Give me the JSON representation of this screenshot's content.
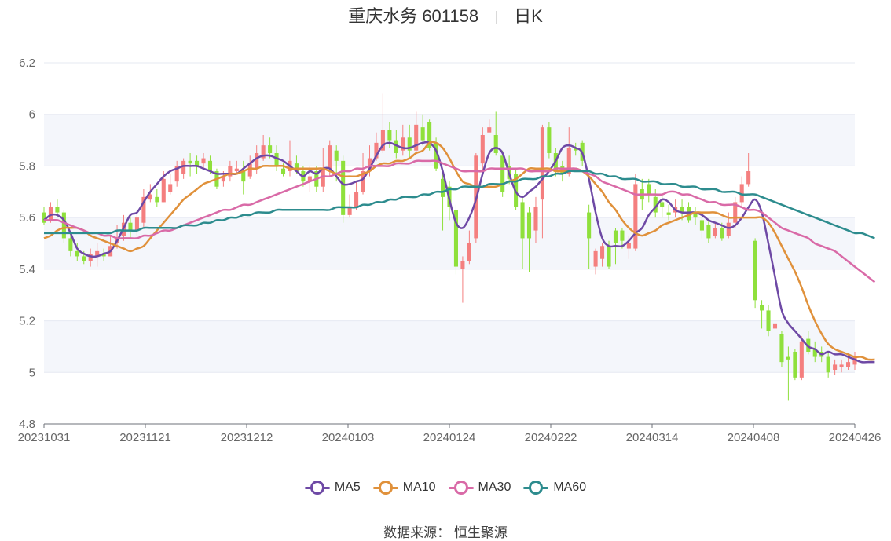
{
  "header": {
    "title": "重庆水务 601158",
    "period": "日K"
  },
  "source": {
    "label": "数据来源：",
    "value": "恒生聚源"
  },
  "colors": {
    "up": "#f47f7f",
    "down": "#8fe03c",
    "band": "#f4f6fb",
    "grid": "#e6e9f2",
    "MA5": "#6e49a5",
    "MA10": "#e0913b",
    "MA30": "#d96aa7",
    "MA60": "#2d8c8e"
  },
  "chart_data": {
    "type": "candlestick",
    "y_axis": {
      "min": 4.8,
      "max": 6.2,
      "ticks": [
        "6.2",
        "6",
        "5.8",
        "5.6",
        "5.4",
        "5.2",
        "5",
        "4.8"
      ]
    },
    "x_ticks": [
      "20231031",
      "20231121",
      "20231212",
      "20240103",
      "20240124",
      "20240222",
      "20240314",
      "20240408",
      "20240426"
    ],
    "legend": [
      "MA5",
      "MA10",
      "MA30",
      "MA60"
    ],
    "candles": [
      [
        5.62,
        5.58,
        5.64,
        5.57
      ],
      [
        5.59,
        5.64,
        5.66,
        5.58
      ],
      [
        5.64,
        5.62,
        5.67,
        5.6
      ],
      [
        5.62,
        5.52,
        5.63,
        5.5
      ],
      [
        5.52,
        5.47,
        5.54,
        5.45
      ],
      [
        5.47,
        5.45,
        5.5,
        5.43
      ],
      [
        5.45,
        5.43,
        5.47,
        5.42
      ],
      [
        5.43,
        5.46,
        5.48,
        5.41
      ],
      [
        5.45,
        5.47,
        5.5,
        5.41
      ],
      [
        5.46,
        5.45,
        5.48,
        5.43
      ],
      [
        5.45,
        5.49,
        5.53,
        5.45
      ],
      [
        5.5,
        5.52,
        5.57,
        5.48
      ],
      [
        5.53,
        5.58,
        5.61,
        5.51
      ],
      [
        5.58,
        5.55,
        5.6,
        5.52
      ],
      [
        5.55,
        5.6,
        5.63,
        5.53
      ],
      [
        5.58,
        5.68,
        5.71,
        5.56
      ],
      [
        5.67,
        5.69,
        5.73,
        5.66
      ],
      [
        5.68,
        5.66,
        5.71,
        5.64
      ],
      [
        5.66,
        5.75,
        5.78,
        5.66
      ],
      [
        5.7,
        5.73,
        5.77,
        5.69
      ],
      [
        5.74,
        5.8,
        5.82,
        5.72
      ],
      [
        5.77,
        5.82,
        5.83,
        5.75
      ],
      [
        5.82,
        5.81,
        5.85,
        5.76
      ],
      [
        5.82,
        5.8,
        5.84,
        5.77
      ],
      [
        5.81,
        5.83,
        5.85,
        5.79
      ],
      [
        5.82,
        5.78,
        5.84,
        5.77
      ],
      [
        5.78,
        5.72,
        5.79,
        5.71
      ],
      [
        5.74,
        5.76,
        5.78,
        5.72
      ],
      [
        5.76,
        5.8,
        5.82,
        5.74
      ],
      [
        5.78,
        5.79,
        5.82,
        5.77
      ],
      [
        5.78,
        5.74,
        5.82,
        5.69
      ],
      [
        5.76,
        5.81,
        5.84,
        5.75
      ],
      [
        5.79,
        5.85,
        5.88,
        5.77
      ],
      [
        5.83,
        5.88,
        5.92,
        5.82
      ],
      [
        5.88,
        5.85,
        5.91,
        5.83
      ],
      [
        5.85,
        5.8,
        5.88,
        5.78
      ],
      [
        5.79,
        5.77,
        5.81,
        5.76
      ],
      [
        5.78,
        5.82,
        5.9,
        5.76
      ],
      [
        5.81,
        5.78,
        5.84,
        5.77
      ],
      [
        5.78,
        5.74,
        5.8,
        5.72
      ],
      [
        5.74,
        5.76,
        5.8,
        5.7
      ],
      [
        5.78,
        5.72,
        5.8,
        5.7
      ],
      [
        5.72,
        5.79,
        5.87,
        5.7
      ],
      [
        5.79,
        5.88,
        5.9,
        5.76
      ],
      [
        5.86,
        5.82,
        5.88,
        5.74
      ],
      [
        5.82,
        5.61,
        5.84,
        5.58
      ],
      [
        5.61,
        5.64,
        5.69,
        5.6
      ],
      [
        5.64,
        5.7,
        5.74,
        5.63
      ],
      [
        5.7,
        5.78,
        5.85,
        5.69
      ],
      [
        5.78,
        5.83,
        5.88,
        5.76
      ],
      [
        5.83,
        5.89,
        5.93,
        5.82
      ],
      [
        5.86,
        5.94,
        6.08,
        5.85
      ],
      [
        5.94,
        5.9,
        5.97,
        5.87
      ],
      [
        5.9,
        5.85,
        5.94,
        5.83
      ],
      [
        5.86,
        5.91,
        5.96,
        5.84
      ],
      [
        5.91,
        5.86,
        5.96,
        5.83
      ],
      [
        5.86,
        5.96,
        6.01,
        5.85
      ],
      [
        5.95,
        5.9,
        6.0,
        5.88
      ],
      [
        5.97,
        5.87,
        5.98,
        5.86
      ],
      [
        5.89,
        5.79,
        5.91,
        5.78
      ],
      [
        5.75,
        5.68,
        5.77,
        5.55
      ],
      [
        5.72,
        5.64,
        5.74,
        5.59
      ],
      [
        5.63,
        5.41,
        5.65,
        5.38
      ],
      [
        5.4,
        5.43,
        5.45,
        5.27
      ],
      [
        5.43,
        5.5,
        5.55,
        5.42
      ],
      [
        5.52,
        5.84,
        5.85,
        5.5
      ],
      [
        5.81,
        5.92,
        5.95,
        5.78
      ],
      [
        5.93,
        5.95,
        5.98,
        5.94
      ],
      [
        5.92,
        5.85,
        6.01,
        5.84
      ],
      [
        5.84,
        5.7,
        5.86,
        5.68
      ],
      [
        5.8,
        5.75,
        5.84,
        5.73
      ],
      [
        5.77,
        5.64,
        5.79,
        5.63
      ],
      [
        5.66,
        5.52,
        5.68,
        5.4
      ],
      [
        5.62,
        5.52,
        5.64,
        5.39
      ],
      [
        5.55,
        5.64,
        5.68,
        5.5
      ],
      [
        5.67,
        5.95,
        5.96,
        5.52
      ],
      [
        5.95,
        5.85,
        5.97,
        5.83
      ],
      [
        5.85,
        5.78,
        5.87,
        5.76
      ],
      [
        5.8,
        5.77,
        5.82,
        5.74
      ],
      [
        5.77,
        5.87,
        5.95,
        5.76
      ],
      [
        5.87,
        5.86,
        5.89,
        5.84
      ],
      [
        5.89,
        5.82,
        5.9,
        5.8
      ],
      [
        5.62,
        5.52,
        5.65,
        5.4
      ],
      [
        5.41,
        5.47,
        5.48,
        5.38
      ],
      [
        5.44,
        5.49,
        5.5,
        5.41
      ],
      [
        5.49,
        5.41,
        5.51,
        5.4
      ],
      [
        5.55,
        5.5,
        5.56,
        5.42
      ],
      [
        5.55,
        5.51,
        5.56,
        5.48
      ],
      [
        5.48,
        5.5,
        5.53,
        5.44
      ],
      [
        5.48,
        5.73,
        5.77,
        5.47
      ],
      [
        5.71,
        5.67,
        5.75,
        5.63
      ],
      [
        5.73,
        5.69,
        5.75,
        5.66
      ],
      [
        5.68,
        5.62,
        5.71,
        5.6
      ],
      [
        5.66,
        5.64,
        5.69,
        5.6
      ],
      [
        5.62,
        5.61,
        5.65,
        5.59
      ],
      [
        5.62,
        5.64,
        5.67,
        5.6
      ],
      [
        5.64,
        5.62,
        5.67,
        5.59
      ],
      [
        5.64,
        5.59,
        5.66,
        5.58
      ],
      [
        5.62,
        5.6,
        5.64,
        5.57
      ],
      [
        5.59,
        5.55,
        5.62,
        5.52
      ],
      [
        5.57,
        5.52,
        5.59,
        5.5
      ],
      [
        5.53,
        5.56,
        5.58,
        5.52
      ],
      [
        5.56,
        5.52,
        5.58,
        5.51
      ],
      [
        5.53,
        5.58,
        5.62,
        5.52
      ],
      [
        5.58,
        5.66,
        5.68,
        5.56
      ],
      [
        5.66,
        5.73,
        5.76,
        5.64
      ],
      [
        5.73,
        5.78,
        5.85,
        5.72
      ],
      [
        5.51,
        5.28,
        5.52,
        5.25
      ],
      [
        5.26,
        5.24,
        5.28,
        5.17
      ],
      [
        5.24,
        5.16,
        5.26,
        5.14
      ],
      [
        5.17,
        5.19,
        5.22,
        5.14
      ],
      [
        5.15,
        5.04,
        5.16,
        5.02
      ],
      [
        5.06,
        5.05,
        5.1,
        4.89
      ],
      [
        5.08,
        4.98,
        5.09,
        4.97
      ],
      [
        4.98,
        5.12,
        5.14,
        4.97
      ],
      [
        5.13,
        5.08,
        5.16,
        5.07
      ],
      [
        5.09,
        5.06,
        5.12,
        5.04
      ],
      [
        5.08,
        5.06,
        5.1,
        5.04
      ],
      [
        5.06,
        5.0,
        5.08,
        4.98
      ],
      [
        5.01,
        5.03,
        5.05,
        4.99
      ],
      [
        5.02,
        5.03,
        5.05,
        5.0
      ],
      [
        5.02,
        5.04,
        5.07,
        5.01
      ],
      [
        5.03,
        5.06,
        5.08,
        5.01
      ]
    ],
    "ma_lines": {
      "MA5": [
        5.59,
        5.61,
        5.61,
        5.59,
        5.54,
        5.48,
        5.46,
        5.45,
        5.45,
        5.46,
        5.47,
        5.51,
        5.56,
        5.61,
        5.62,
        5.66,
        5.7,
        5.73,
        5.76,
        5.78,
        5.79,
        5.8,
        5.8,
        5.8,
        5.79,
        5.78,
        5.77,
        5.77,
        5.77,
        5.77,
        5.79,
        5.81,
        5.83,
        5.84,
        5.84,
        5.83,
        5.82,
        5.8,
        5.78,
        5.76,
        5.78,
        5.77,
        5.79,
        5.79,
        5.76,
        5.73,
        5.73,
        5.74,
        5.75,
        5.79,
        5.84,
        5.88,
        5.89,
        5.88,
        5.87,
        5.87,
        5.88,
        5.89,
        5.89,
        5.86,
        5.78,
        5.67,
        5.58,
        5.56,
        5.6,
        5.67,
        5.77,
        5.85,
        5.87,
        5.85,
        5.77,
        5.7,
        5.68,
        5.7,
        5.72,
        5.75,
        5.78,
        5.82,
        5.87,
        5.88,
        5.87,
        5.85,
        5.75,
        5.62,
        5.52,
        5.49,
        5.49,
        5.49,
        5.51,
        5.54,
        5.56,
        5.61,
        5.64,
        5.67,
        5.66,
        5.63,
        5.62,
        5.62,
        5.62,
        5.61,
        5.59,
        5.58,
        5.57,
        5.56,
        5.57,
        5.6,
        5.64,
        5.67,
        5.62,
        5.5,
        5.37,
        5.24,
        5.19,
        5.16,
        5.13,
        5.1,
        5.09,
        5.07,
        5.08,
        5.07,
        5.07,
        5.06,
        5.05,
        5.04,
        5.04,
        5.04
      ],
      "MA10": [
        5.52,
        5.53,
        5.55,
        5.56,
        5.56,
        5.56,
        5.55,
        5.53,
        5.52,
        5.51,
        5.5,
        5.49,
        5.48,
        5.47,
        5.48,
        5.49,
        5.52,
        5.55,
        5.58,
        5.61,
        5.64,
        5.67,
        5.69,
        5.71,
        5.73,
        5.74,
        5.75,
        5.76,
        5.77,
        5.77,
        5.78,
        5.79,
        5.79,
        5.8,
        5.8,
        5.8,
        5.8,
        5.79,
        5.79,
        5.79,
        5.79,
        5.79,
        5.79,
        5.78,
        5.77,
        5.76,
        5.76,
        5.76,
        5.77,
        5.78,
        5.8,
        5.81,
        5.81,
        5.82,
        5.82,
        5.83,
        5.85,
        5.86,
        5.89,
        5.89,
        5.87,
        5.83,
        5.78,
        5.74,
        5.73,
        5.72,
        5.72,
        5.72,
        5.72,
        5.73,
        5.74,
        5.75,
        5.77,
        5.79,
        5.79,
        5.79,
        5.79,
        5.78,
        5.78,
        5.78,
        5.79,
        5.78,
        5.76,
        5.73,
        5.7,
        5.66,
        5.63,
        5.59,
        5.56,
        5.54,
        5.53,
        5.54,
        5.55,
        5.57,
        5.58,
        5.59,
        5.6,
        5.61,
        5.62,
        5.62,
        5.62,
        5.62,
        5.61,
        5.6,
        5.6,
        5.6,
        5.6,
        5.6,
        5.6,
        5.58,
        5.54,
        5.49,
        5.44,
        5.39,
        5.33,
        5.26,
        5.2,
        5.15,
        5.11,
        5.09,
        5.08,
        5.07,
        5.06,
        5.06,
        5.05,
        5.05
      ],
      "MA30": [
        5.59,
        5.59,
        5.59,
        5.58,
        5.57,
        5.56,
        5.55,
        5.54,
        5.54,
        5.53,
        5.53,
        5.52,
        5.52,
        5.52,
        5.52,
        5.53,
        5.53,
        5.54,
        5.55,
        5.55,
        5.56,
        5.57,
        5.58,
        5.59,
        5.6,
        5.61,
        5.62,
        5.63,
        5.63,
        5.64,
        5.65,
        5.65,
        5.66,
        5.67,
        5.68,
        5.69,
        5.7,
        5.71,
        5.72,
        5.73,
        5.74,
        5.75,
        5.76,
        5.76,
        5.77,
        5.78,
        5.78,
        5.79,
        5.79,
        5.8,
        5.8,
        5.8,
        5.8,
        5.81,
        5.81,
        5.81,
        5.82,
        5.82,
        5.82,
        5.82,
        5.81,
        5.8,
        5.79,
        5.78,
        5.78,
        5.78,
        5.78,
        5.79,
        5.79,
        5.79,
        5.79,
        5.79,
        5.79,
        5.78,
        5.78,
        5.78,
        5.78,
        5.79,
        5.79,
        5.79,
        5.79,
        5.78,
        5.77,
        5.76,
        5.74,
        5.73,
        5.72,
        5.71,
        5.7,
        5.69,
        5.69,
        5.69,
        5.69,
        5.69,
        5.7,
        5.7,
        5.69,
        5.69,
        5.68,
        5.67,
        5.66,
        5.66,
        5.65,
        5.65,
        5.65,
        5.64,
        5.63,
        5.63,
        5.62,
        5.6,
        5.58,
        5.56,
        5.55,
        5.54,
        5.53,
        5.52,
        5.5,
        5.49,
        5.48,
        5.47,
        5.45,
        5.43,
        5.41,
        5.39,
        5.37,
        5.35
      ],
      "MA60": [
        5.54,
        5.54,
        5.54,
        5.54,
        5.54,
        5.54,
        5.54,
        5.54,
        5.54,
        5.54,
        5.54,
        5.55,
        5.55,
        5.55,
        5.55,
        5.56,
        5.56,
        5.56,
        5.56,
        5.56,
        5.56,
        5.57,
        5.57,
        5.57,
        5.58,
        5.58,
        5.59,
        5.59,
        5.6,
        5.6,
        5.61,
        5.61,
        5.62,
        5.62,
        5.62,
        5.63,
        5.63,
        5.63,
        5.63,
        5.63,
        5.63,
        5.63,
        5.63,
        5.63,
        5.64,
        5.64,
        5.64,
        5.64,
        5.65,
        5.65,
        5.66,
        5.66,
        5.67,
        5.67,
        5.68,
        5.68,
        5.68,
        5.69,
        5.69,
        5.7,
        5.7,
        5.71,
        5.71,
        5.72,
        5.72,
        5.72,
        5.72,
        5.73,
        5.73,
        5.73,
        5.74,
        5.74,
        5.75,
        5.75,
        5.75,
        5.76,
        5.76,
        5.77,
        5.77,
        5.78,
        5.78,
        5.78,
        5.78,
        5.77,
        5.77,
        5.76,
        5.76,
        5.75,
        5.75,
        5.75,
        5.74,
        5.74,
        5.74,
        5.73,
        5.73,
        5.73,
        5.72,
        5.72,
        5.72,
        5.71,
        5.71,
        5.71,
        5.7,
        5.7,
        5.7,
        5.69,
        5.69,
        5.69,
        5.68,
        5.67,
        5.66,
        5.65,
        5.64,
        5.63,
        5.62,
        5.61,
        5.6,
        5.59,
        5.58,
        5.57,
        5.56,
        5.55,
        5.54,
        5.54,
        5.53,
        5.52
      ]
    }
  }
}
